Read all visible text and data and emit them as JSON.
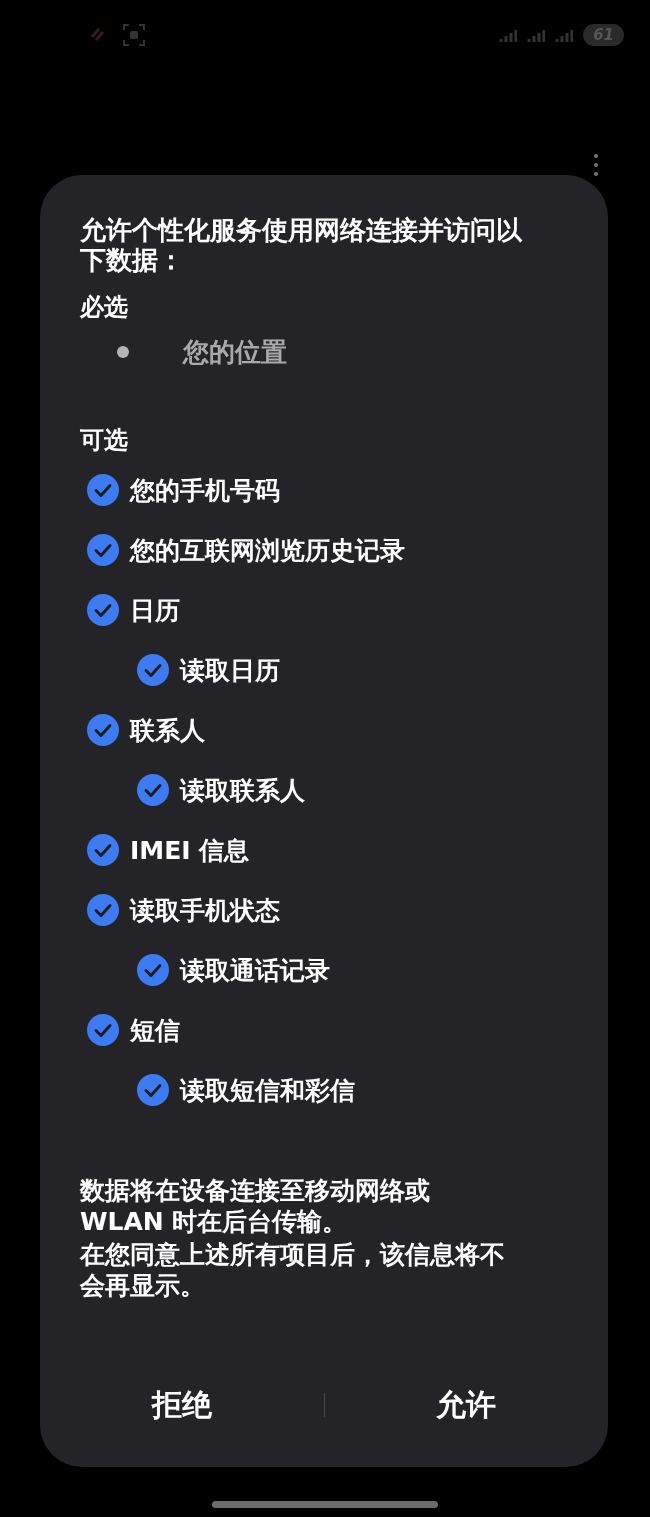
{
  "status_bar": {
    "battery": "61"
  },
  "dialog": {
    "title": "允许个性化服务使用网络连接并访问以下数据：",
    "required": {
      "heading": "必选",
      "items": [
        "您的位置"
      ]
    },
    "optional": {
      "heading": "可选",
      "items": [
        {
          "label": "您的手机号码",
          "checked": true
        },
        {
          "label": "您的互联网浏览历史记录",
          "checked": true
        },
        {
          "label": "日历",
          "checked": true,
          "children": [
            {
              "label": "读取日历",
              "checked": true
            }
          ]
        },
        {
          "label": "联系人",
          "checked": true,
          "children": [
            {
              "label": "读取联系人",
              "checked": true
            }
          ]
        },
        {
          "label": "IMEI 信息",
          "checked": true
        },
        {
          "label": "读取手机状态",
          "checked": true,
          "children": [
            {
              "label": "读取通话记录",
              "checked": true
            }
          ]
        },
        {
          "label": "短信",
          "checked": true,
          "children": [
            {
              "label": "读取短信和彩信",
              "checked": true
            }
          ]
        }
      ]
    },
    "notes": [
      "数据将在设备连接至移动网络或 WLAN 时在后台传输。",
      "在您同意上述所有项目后，该信息将不会再显示。"
    ],
    "buttons": [
      "拒绝",
      "允许"
    ]
  }
}
